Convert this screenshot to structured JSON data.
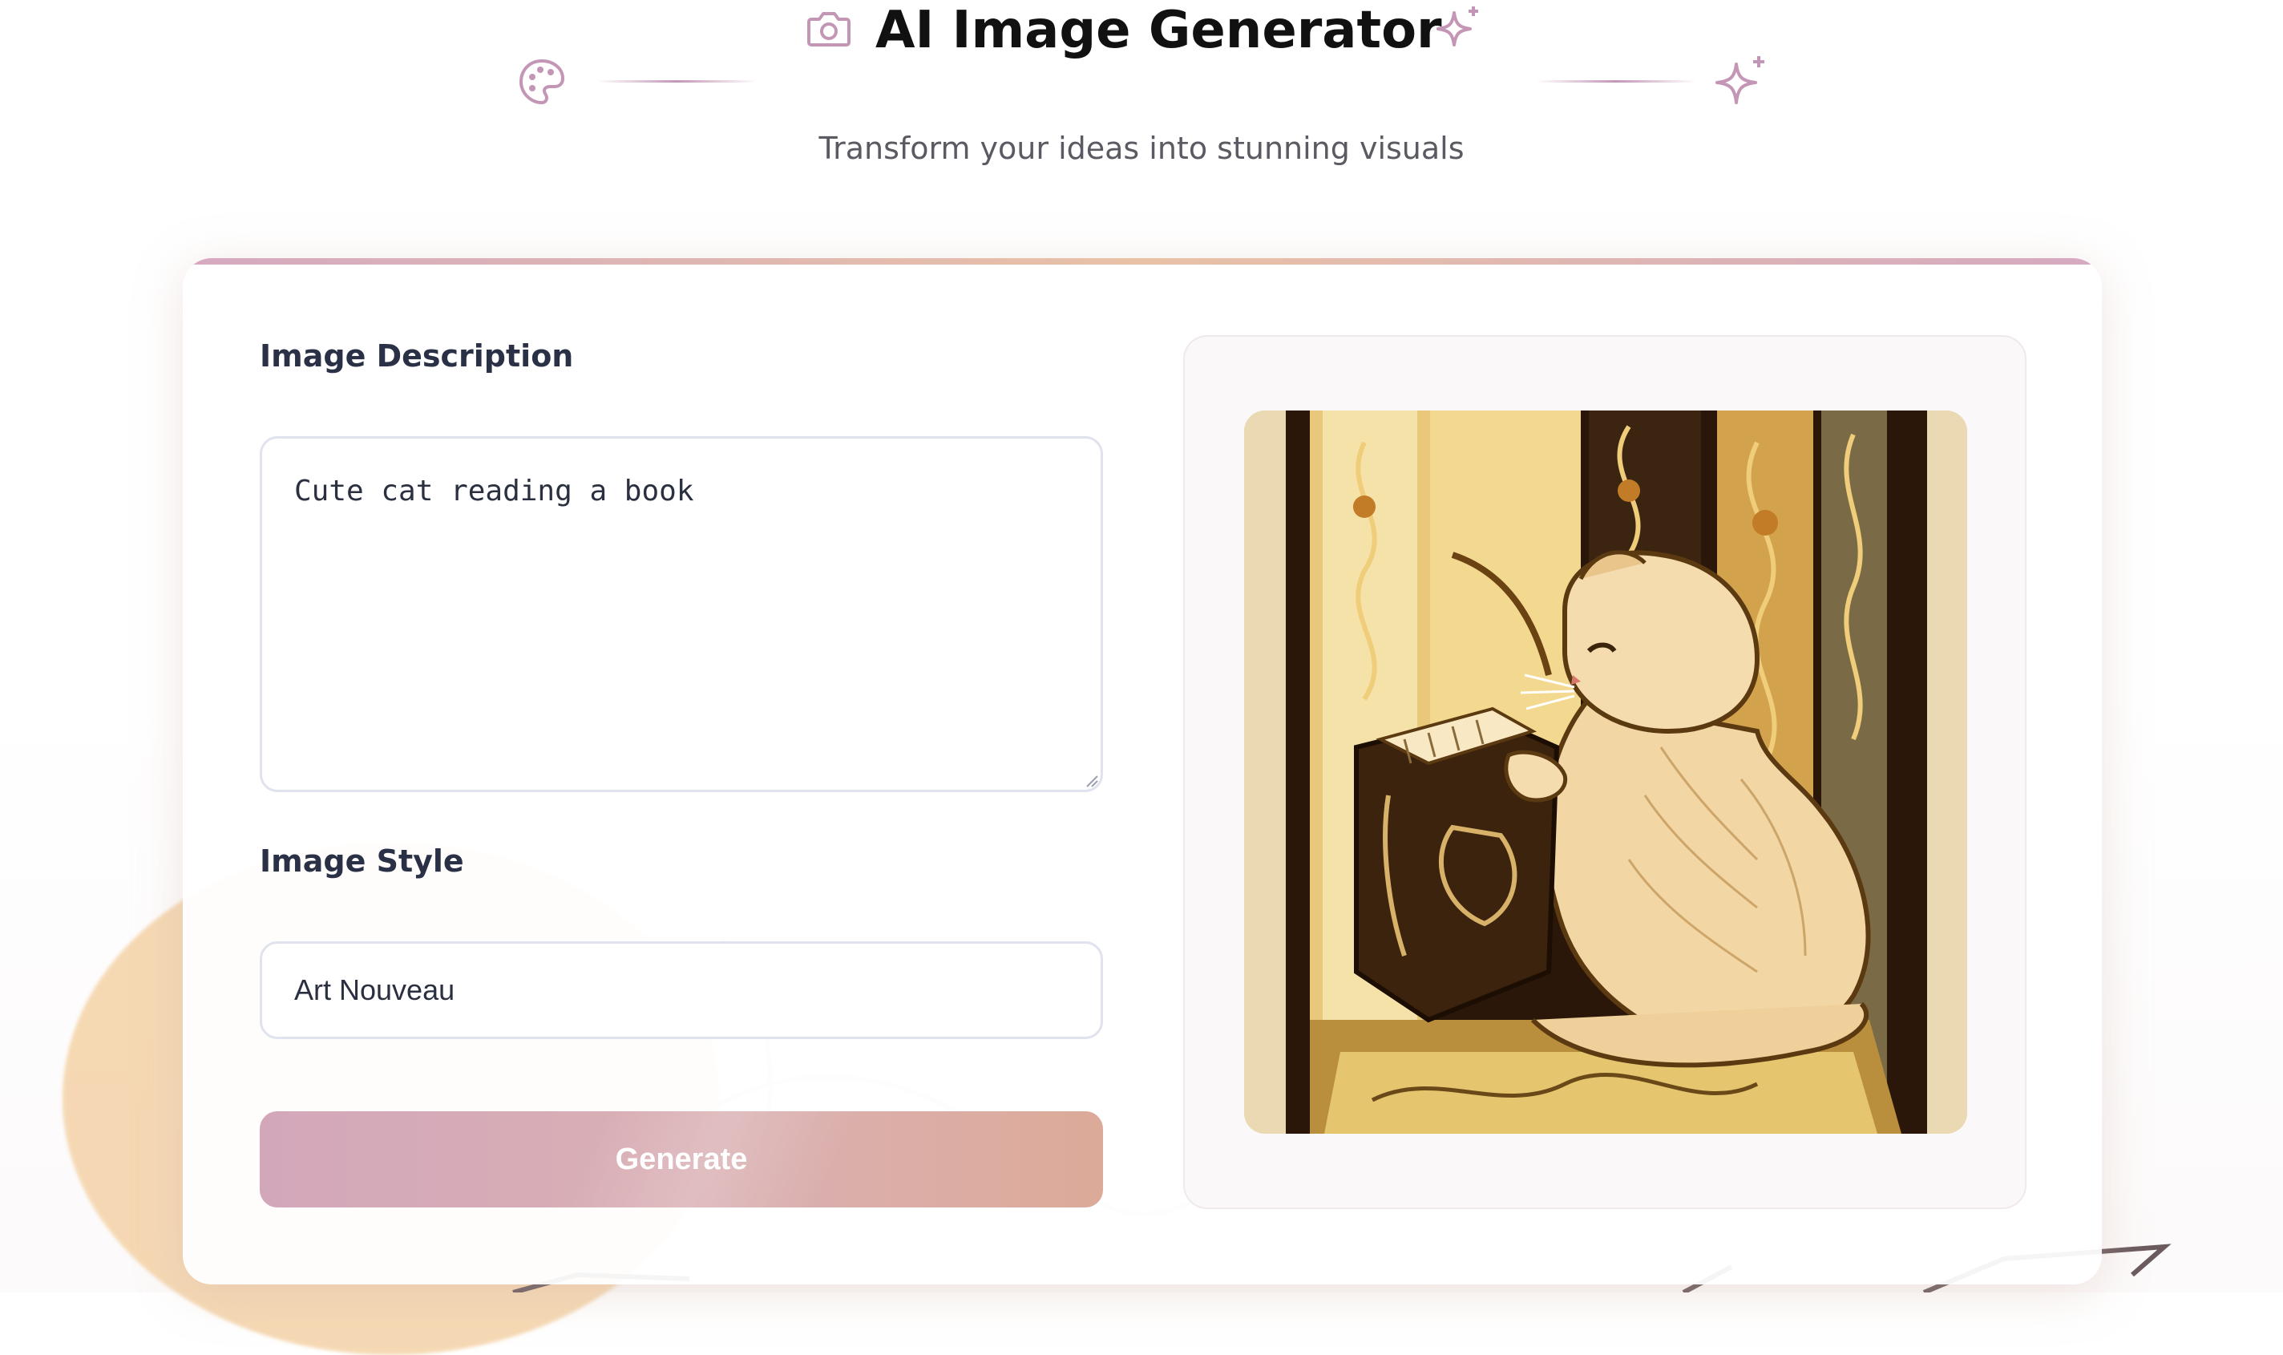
{
  "header": {
    "title": "AI Image Generator",
    "subtitle": "Transform your ideas into stunning visuals",
    "icons": [
      "camera-icon",
      "sparkle-icon",
      "palette-icon",
      "sparkle-icon"
    ]
  },
  "form": {
    "description_label": "Image Description",
    "description_value": "Cute cat reading a book",
    "style_label": "Image Style",
    "style_value": "Art Nouveau",
    "generate_label": "Generate"
  },
  "preview": {
    "image_alt": "Art Nouveau style cat reading a book"
  },
  "colors": {
    "accent_pink": "#d3a7ba",
    "accent_peach": "#dcaa98",
    "icon_mauve": "#c496b6",
    "title_text": "#111111",
    "label_text": "#2a3146"
  }
}
